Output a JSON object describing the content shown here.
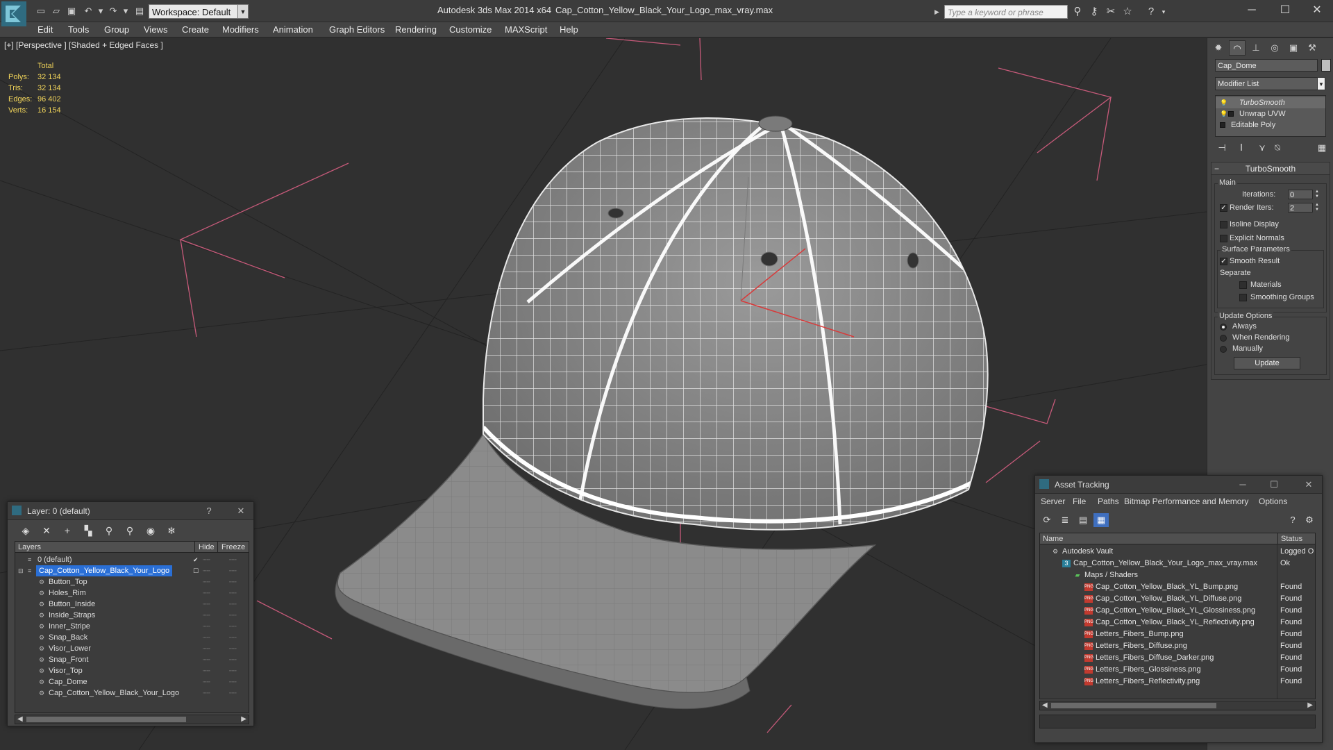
{
  "titlebar": {
    "workspace": "Workspace: Default",
    "app_title": "Autodesk 3ds Max  2014 x64",
    "file_title": "Cap_Cotton_Yellow_Black_Your_Logo_max_vray.max",
    "search_placeholder": "Type a keyword or phrase"
  },
  "menu": [
    "Edit",
    "Tools",
    "Group",
    "Views",
    "Create",
    "Modifiers",
    "Animation",
    "Graph Editors",
    "Rendering",
    "Customize",
    "MAXScript",
    "Help"
  ],
  "viewport": {
    "label": "[+] [Perspective ] [Shaded + Edged Faces ]",
    "stats_header": "Total",
    "stats": [
      {
        "label": "Polys:",
        "value": "32 134"
      },
      {
        "label": "Tris:",
        "value": "32 134"
      },
      {
        "label": "Edges:",
        "value": "96 402"
      },
      {
        "label": "Verts:",
        "value": "16 154"
      }
    ]
  },
  "command_panel": {
    "object_name": "Cap_Dome",
    "modifier_list": "Modifier List",
    "stack": [
      "TurboSmooth",
      "Unwrap UVW",
      "Editable Poly"
    ],
    "rollout": {
      "title": "TurboSmooth",
      "main_label": "Main",
      "iterations_label": "Iterations:",
      "iterations_value": "0",
      "render_iters_label": "Render Iters:",
      "render_iters_value": "2",
      "isoline_label": "Isoline Display",
      "explicit_label": "Explicit Normals",
      "surface_label": "Surface Parameters",
      "smooth_result_label": "Smooth Result",
      "separate_label": "Separate",
      "materials_label": "Materials",
      "smoothing_groups_label": "Smoothing Groups",
      "update_options_label": "Update Options",
      "always_label": "Always",
      "when_rendering_label": "When Rendering",
      "manually_label": "Manually",
      "update_button": "Update"
    }
  },
  "layer_dialog": {
    "title": "Layer: 0 (default)",
    "help": "?",
    "columns": {
      "layers": "Layers",
      "hide": "Hide",
      "freeze": "Freeze"
    },
    "rows": [
      {
        "name": "0 (default)",
        "level": 0
      },
      {
        "name": "Cap_Cotton_Yellow_Black_Your_Logo",
        "level": 0
      },
      {
        "name": "Button_Top",
        "level": 1
      },
      {
        "name": "Holes_Rim",
        "level": 1
      },
      {
        "name": "Button_Inside",
        "level": 1
      },
      {
        "name": "Inside_Straps",
        "level": 1
      },
      {
        "name": "Inner_Stripe",
        "level": 1
      },
      {
        "name": "Snap_Back",
        "level": 1
      },
      {
        "name": "Visor_Lower",
        "level": 1
      },
      {
        "name": "Snap_Front",
        "level": 1
      },
      {
        "name": "Visor_Top",
        "level": 1
      },
      {
        "name": "Cap_Dome",
        "level": 1
      },
      {
        "name": "Cap_Cotton_Yellow_Black_Your_Logo",
        "level": 1
      }
    ]
  },
  "asset_dialog": {
    "title": "Asset Tracking",
    "menu": [
      "Server",
      "File",
      "Paths",
      "Bitmap Performance and Memory",
      "Options"
    ],
    "columns": {
      "name": "Name",
      "status": "Status"
    },
    "rows": [
      {
        "name": "Autodesk Vault",
        "status": "Logged O",
        "icon": "vault"
      },
      {
        "name": "Cap_Cotton_Yellow_Black_Your_Logo_max_vray.max",
        "status": "Ok",
        "icon": "max"
      },
      {
        "name": "Maps / Shaders",
        "status": "",
        "icon": "maps"
      },
      {
        "name": "Cap_Cotton_Yellow_Black_YL_Bump.png",
        "status": "Found",
        "icon": "png"
      },
      {
        "name": "Cap_Cotton_Yellow_Black_YL_Diffuse.png",
        "status": "Found",
        "icon": "png"
      },
      {
        "name": "Cap_Cotton_Yellow_Black_YL_Glossiness.png",
        "status": "Found",
        "icon": "png"
      },
      {
        "name": "Cap_Cotton_Yellow_Black_YL_Reflectivity.png",
        "status": "Found",
        "icon": "png"
      },
      {
        "name": "Letters_Fibers_Bump.png",
        "status": "Found",
        "icon": "png"
      },
      {
        "name": "Letters_Fibers_Diffuse.png",
        "status": "Found",
        "icon": "png"
      },
      {
        "name": "Letters_Fibers_Diffuse_Darker.png",
        "status": "Found",
        "icon": "png"
      },
      {
        "name": "Letters_Fibers_Glossiness.png",
        "status": "Found",
        "icon": "png"
      },
      {
        "name": "Letters_Fibers_Reflectivity.png",
        "status": "Found",
        "icon": "png"
      }
    ]
  },
  "colors": {
    "viewport_bg": "#303030",
    "stats_text": "#f2d55a",
    "selection": "#2a6fd6",
    "png_icon": "#c23a2f"
  }
}
